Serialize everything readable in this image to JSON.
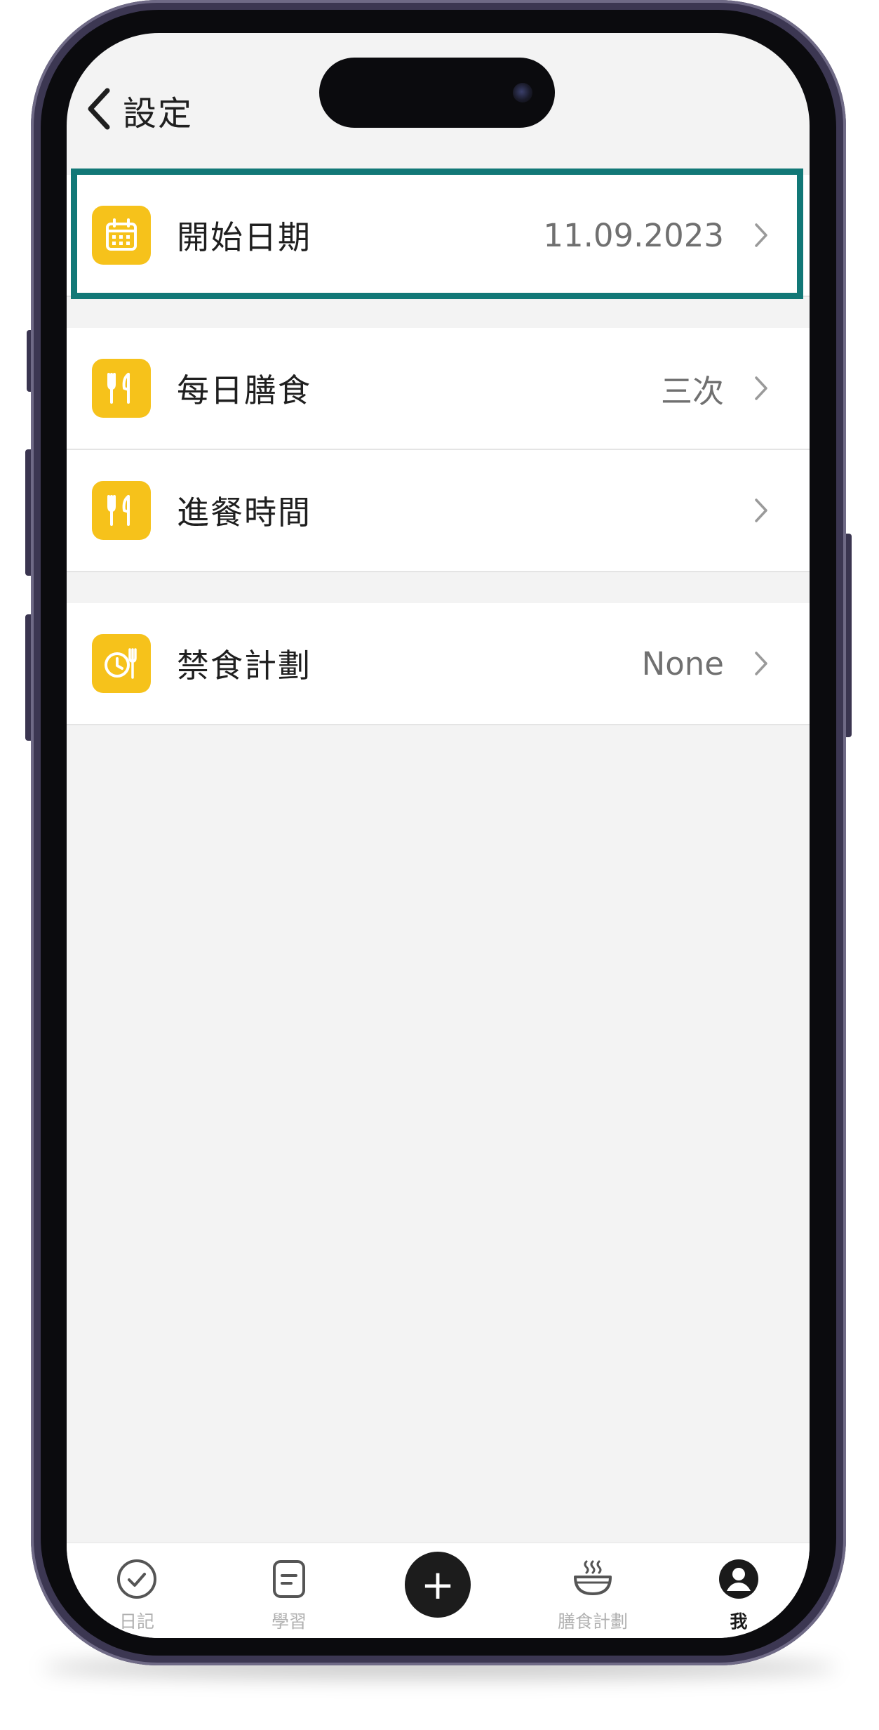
{
  "header": {
    "back_icon": "chevron-left-icon",
    "title": "設定"
  },
  "sections": [
    {
      "items": [
        {
          "icon": "calendar-icon",
          "label": "開始日期",
          "value": "11.09.2023",
          "highlighted": true
        }
      ]
    },
    {
      "items": [
        {
          "icon": "fork-knife-icon",
          "label": "每日膳食",
          "value": "三次"
        },
        {
          "icon": "fork-knife-icon",
          "label": "進餐時間",
          "value": ""
        }
      ]
    },
    {
      "items": [
        {
          "icon": "clock-fork-icon",
          "label": "禁食計劃",
          "value": "None"
        }
      ]
    }
  ],
  "tabbar": {
    "items": [
      {
        "icon": "check-circle-icon",
        "label": "日記"
      },
      {
        "icon": "note-icon",
        "label": "學習"
      },
      {
        "icon": "plus-icon",
        "label": ""
      },
      {
        "icon": "steaming-bowl-icon",
        "label": "膳食計劃"
      },
      {
        "icon": "user-icon",
        "label": "我",
        "active": true
      }
    ]
  },
  "colors": {
    "accent_icon": "#f6c21b",
    "highlight_border": "#127877",
    "background": "#f3f3f3"
  }
}
